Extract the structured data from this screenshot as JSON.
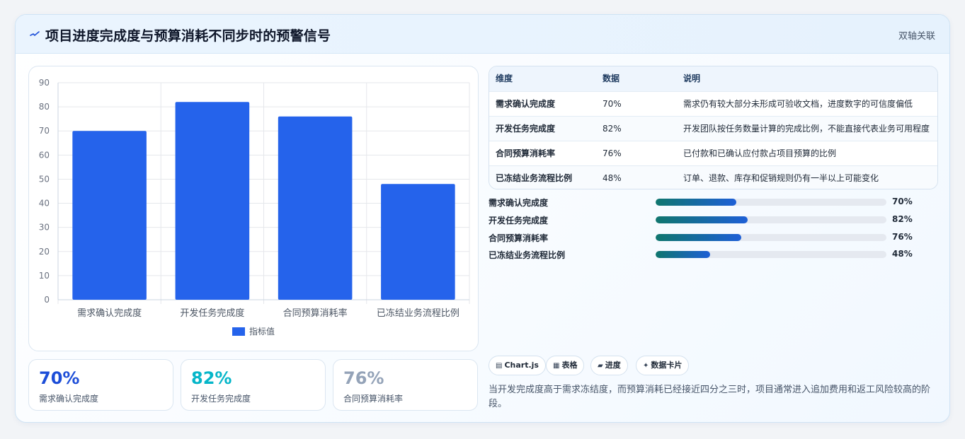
{
  "header": {
    "icon": "pulse-icon",
    "title": "项目进度完成度与预算消耗不同步时的预警信号",
    "tag": "双轴关联"
  },
  "chart_data": {
    "type": "bar",
    "categories": [
      "需求确认完成度",
      "开发任务完成度",
      "合同预算消耗率",
      "已冻结业务流程比例"
    ],
    "series": [
      {
        "name": "指标值",
        "values": [
          70,
          82,
          76,
          48
        ],
        "color": "#2563eb"
      }
    ],
    "ylim": [
      0,
      90
    ],
    "yticks": [
      0,
      10,
      20,
      30,
      40,
      50,
      60,
      70,
      80,
      90
    ],
    "grid": true,
    "legend": "bottom"
  },
  "kpis": [
    {
      "value": "70%",
      "label": "需求确认完成度",
      "color": "#1d4ed8"
    },
    {
      "value": "82%",
      "label": "开发任务完成度",
      "color": "#06b6c9"
    },
    {
      "value": "76%",
      "label": "合同预算消耗率",
      "color": "#94a3b8"
    }
  ],
  "table": {
    "headers": [
      "维度",
      "数据",
      "说明"
    ],
    "rows": [
      [
        "需求确认完成度",
        "70%",
        "需求仍有较大部分未形成可验收文档，进度数字的可信度偏低"
      ],
      [
        "开发任务完成度",
        "82%",
        "开发团队按任务数量计算的完成比例，不能直接代表业务可用程度"
      ],
      [
        "合同预算消耗率",
        "76%",
        "已付款和已确认应付款占项目预算的比例"
      ],
      [
        "已冻结业务流程比例",
        "48%",
        "订单、退款、库存和促销规则仍有一半以上可能变化"
      ]
    ]
  },
  "progress": [
    {
      "label": "需求确认完成度",
      "value": "70%",
      "level": 35
    },
    {
      "label": "开发任务完成度",
      "value": "82%",
      "level": 40
    },
    {
      "label": "合同预算消耗率",
      "value": "76%",
      "level": 37
    },
    {
      "label": "已冻结业务流程比例",
      "value": "48%",
      "level": 23.5
    }
  ],
  "chips": [
    {
      "icon": "chart-icon",
      "glyph": "▤",
      "label": "Chart.js"
    },
    {
      "icon": "table-icon",
      "glyph": "▦",
      "label": "表格"
    },
    {
      "icon": "progress-icon",
      "glyph": "▰",
      "label": "进度"
    },
    {
      "icon": "sparkle-icon",
      "glyph": "✦",
      "label": "数据卡片"
    }
  ],
  "footnote": "当开发完成度高于需求冻结度，而预算消耗已经接近四分之三时，项目通常进入追加费用和返工风险较高的阶段。"
}
